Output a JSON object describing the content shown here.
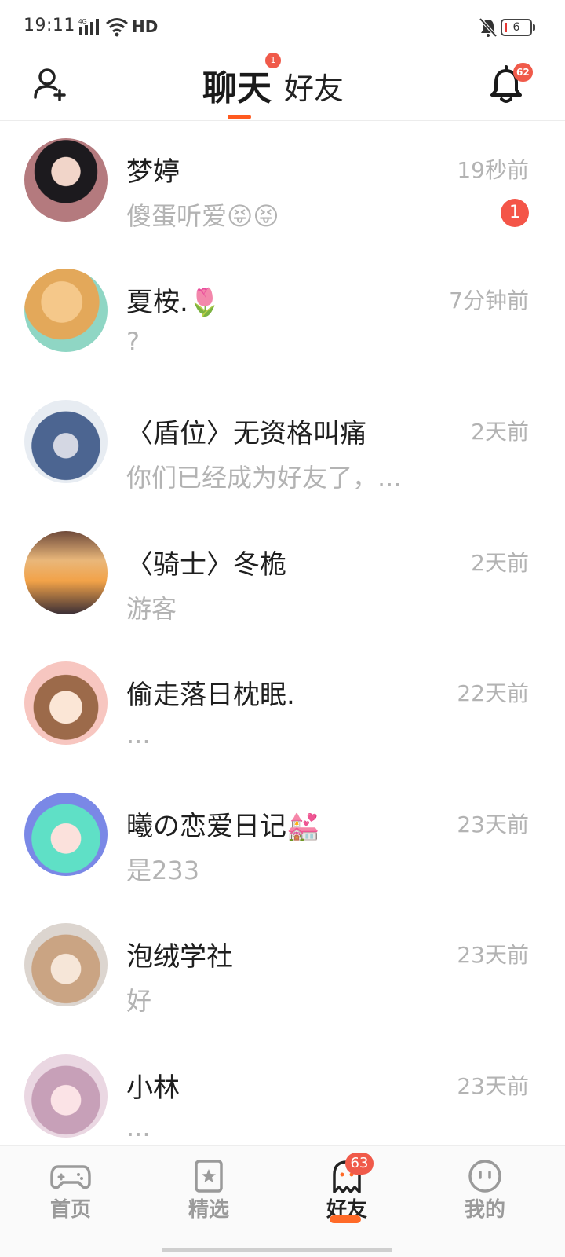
{
  "status_bar": {
    "time": "19:11",
    "network": "HD",
    "battery": "6"
  },
  "header": {
    "tab_chat": "聊天",
    "tab_friends": "好友",
    "chat_tab_dot": "1",
    "notification_count": "62"
  },
  "chats": [
    {
      "name": "梦婷",
      "preview": "傻蛋听爱😝😝",
      "time": "19秒前",
      "unread": "1"
    },
    {
      "name": "夏桉.🌷",
      "preview": "?",
      "time": "7分钟前"
    },
    {
      "name": "〈盾位〉无资格叫痛",
      "preview": "你们已经成为好友了，...",
      "time": "2天前"
    },
    {
      "name": "〈骑士〉冬桅",
      "preview": "游客",
      "time": "2天前"
    },
    {
      "name": "偷走落日枕眠.",
      "preview": "...",
      "time": "22天前"
    },
    {
      "name": "曦の恋爱日记💒",
      "preview": "是233",
      "time": "23天前"
    },
    {
      "name": "泡绒学社",
      "preview": "好",
      "time": "23天前"
    },
    {
      "name": "小林",
      "preview": "...",
      "time": "23天前"
    }
  ],
  "bottom_nav": {
    "home": "首页",
    "featured": "精选",
    "friends": "好友",
    "mine": "我的",
    "friends_badge": "63"
  }
}
